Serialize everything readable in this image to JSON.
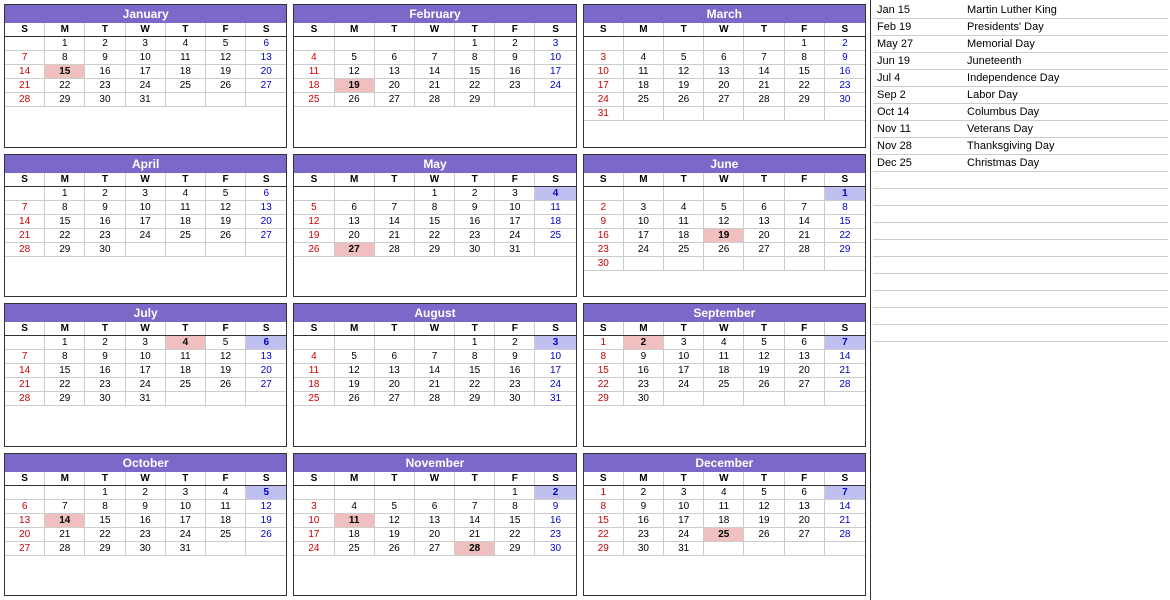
{
  "calendar": {
    "months": [
      {
        "name": "January",
        "startDay": 1,
        "days": 31,
        "weeks": [
          [
            null,
            1,
            2,
            3,
            4,
            5,
            6
          ],
          [
            7,
            8,
            9,
            10,
            11,
            12,
            13
          ],
          [
            14,
            15,
            16,
            17,
            18,
            19,
            20
          ],
          [
            21,
            22,
            23,
            24,
            25,
            26,
            27
          ],
          [
            28,
            29,
            30,
            31,
            null,
            null,
            null
          ]
        ],
        "holidays": [
          15
        ],
        "holidaySat": [],
        "redSundays": [
          7,
          14,
          21,
          28
        ],
        "blueSaturdays": [
          6,
          13,
          20,
          27
        ]
      },
      {
        "name": "February",
        "startDay": 4,
        "days": 29,
        "weeks": [
          [
            null,
            null,
            null,
            null,
            1,
            2,
            3
          ],
          [
            4,
            5,
            6,
            7,
            8,
            9,
            10
          ],
          [
            11,
            12,
            13,
            14,
            15,
            16,
            17
          ],
          [
            18,
            19,
            20,
            21,
            22,
            23,
            24
          ],
          [
            25,
            26,
            27,
            28,
            29,
            null,
            null
          ]
        ],
        "holidays": [
          19
        ],
        "holidaySat": [],
        "redSundays": [
          4,
          11,
          18,
          25
        ],
        "blueSaturdays": [
          3,
          10,
          17,
          24
        ]
      },
      {
        "name": "March",
        "startDay": 5,
        "days": 31,
        "weeks": [
          [
            null,
            null,
            null,
            null,
            null,
            1,
            2
          ],
          [
            3,
            4,
            5,
            6,
            7,
            8,
            9
          ],
          [
            10,
            11,
            12,
            13,
            14,
            15,
            16
          ],
          [
            17,
            18,
            19,
            20,
            21,
            22,
            23
          ],
          [
            24,
            25,
            26,
            27,
            28,
            29,
            30
          ],
          [
            31,
            null,
            null,
            null,
            null,
            null,
            null
          ]
        ],
        "holidays": [],
        "holidaySat": [],
        "redSundays": [
          3,
          10,
          17,
          24,
          31
        ],
        "blueSaturdays": [
          2,
          9,
          16,
          23,
          30
        ]
      },
      {
        "name": "April",
        "startDay": 1,
        "days": 30,
        "weeks": [
          [
            null,
            1,
            2,
            3,
            4,
            5,
            6
          ],
          [
            7,
            8,
            9,
            10,
            11,
            12,
            13
          ],
          [
            14,
            15,
            16,
            17,
            18,
            19,
            20
          ],
          [
            21,
            22,
            23,
            24,
            25,
            26,
            27
          ],
          [
            28,
            29,
            30,
            null,
            null,
            null,
            null
          ]
        ],
        "holidays": [],
        "holidaySat": [],
        "redSundays": [
          7,
          14,
          21,
          28
        ],
        "blueSaturdays": [
          6,
          13,
          20,
          27
        ]
      },
      {
        "name": "May",
        "startDay": 3,
        "days": 31,
        "weeks": [
          [
            null,
            null,
            null,
            1,
            2,
            3,
            4
          ],
          [
            5,
            6,
            7,
            8,
            9,
            10,
            11
          ],
          [
            12,
            13,
            14,
            15,
            16,
            17,
            18
          ],
          [
            19,
            20,
            21,
            22,
            23,
            24,
            25
          ],
          [
            26,
            27,
            28,
            29,
            30,
            31,
            null
          ]
        ],
        "holidays": [
          27
        ],
        "holidaySat": [
          4
        ],
        "redSundays": [
          5,
          12,
          19,
          26
        ],
        "blueSaturdays": [
          4,
          11,
          18,
          25
        ]
      },
      {
        "name": "June",
        "startDay": 6,
        "days": 30,
        "weeks": [
          [
            null,
            null,
            null,
            null,
            null,
            null,
            1
          ],
          [
            2,
            3,
            4,
            5,
            6,
            7,
            8
          ],
          [
            9,
            10,
            11,
            12,
            13,
            14,
            15
          ],
          [
            16,
            17,
            18,
            19,
            20,
            21,
            22
          ],
          [
            23,
            24,
            25,
            26,
            27,
            28,
            29
          ],
          [
            30,
            null,
            null,
            null,
            null,
            null,
            null
          ]
        ],
        "holidays": [
          19
        ],
        "holidaySat": [
          1
        ],
        "redSundays": [
          2,
          9,
          16,
          23,
          30
        ],
        "blueSaturdays": [
          1,
          8,
          15,
          22,
          29
        ]
      },
      {
        "name": "July",
        "startDay": 1,
        "days": 31,
        "weeks": [
          [
            null,
            1,
            2,
            3,
            4,
            5,
            6
          ],
          [
            7,
            8,
            9,
            10,
            11,
            12,
            13
          ],
          [
            14,
            15,
            16,
            17,
            18,
            19,
            20
          ],
          [
            21,
            22,
            23,
            24,
            25,
            26,
            27
          ],
          [
            28,
            29,
            30,
            31,
            null,
            null,
            null
          ]
        ],
        "holidays": [
          4
        ],
        "holidaySat": [
          6
        ],
        "redSundays": [
          7,
          14,
          21,
          28
        ],
        "blueSaturdays": [
          6,
          13,
          20,
          27
        ]
      },
      {
        "name": "August",
        "startDay": 4,
        "days": 31,
        "weeks": [
          [
            null,
            null,
            null,
            null,
            1,
            2,
            3
          ],
          [
            4,
            5,
            6,
            7,
            8,
            9,
            10
          ],
          [
            11,
            12,
            13,
            14,
            15,
            16,
            17
          ],
          [
            18,
            19,
            20,
            21,
            22,
            23,
            24
          ],
          [
            25,
            26,
            27,
            28,
            29,
            30,
            31
          ]
        ],
        "holidays": [],
        "holidaySat": [
          3
        ],
        "redSundays": [
          4,
          11,
          18,
          25
        ],
        "blueSaturdays": [
          3,
          10,
          17,
          24,
          31
        ]
      },
      {
        "name": "September",
        "startDay": 0,
        "days": 30,
        "weeks": [
          [
            1,
            2,
            3,
            4,
            5,
            6,
            7
          ],
          [
            8,
            9,
            10,
            11,
            12,
            13,
            14
          ],
          [
            15,
            16,
            17,
            18,
            19,
            20,
            21
          ],
          [
            22,
            23,
            24,
            25,
            26,
            27,
            28
          ],
          [
            29,
            30,
            null,
            null,
            null,
            null,
            null
          ]
        ],
        "holidays": [
          2
        ],
        "holidaySat": [
          7
        ],
        "redSundays": [
          1,
          8,
          15,
          22,
          29
        ],
        "blueSaturdays": [
          7,
          14,
          21,
          28
        ]
      },
      {
        "name": "October",
        "startDay": 2,
        "days": 31,
        "weeks": [
          [
            null,
            null,
            1,
            2,
            3,
            4,
            5
          ],
          [
            6,
            7,
            8,
            9,
            10,
            11,
            12
          ],
          [
            13,
            14,
            15,
            16,
            17,
            18,
            19
          ],
          [
            20,
            21,
            22,
            23,
            24,
            25,
            26
          ],
          [
            27,
            28,
            29,
            30,
            31,
            null,
            null
          ]
        ],
        "holidays": [
          14
        ],
        "holidaySat": [
          5
        ],
        "redSundays": [
          6,
          13,
          20,
          27
        ],
        "blueSaturdays": [
          5,
          12,
          19,
          26
        ]
      },
      {
        "name": "November",
        "startDay": 5,
        "days": 30,
        "weeks": [
          [
            null,
            null,
            null,
            null,
            null,
            1,
            2
          ],
          [
            3,
            4,
            5,
            6,
            7,
            8,
            9
          ],
          [
            10,
            11,
            12,
            13,
            14,
            15,
            16
          ],
          [
            17,
            18,
            19,
            20,
            21,
            22,
            23
          ],
          [
            24,
            25,
            26,
            27,
            28,
            29,
            30
          ]
        ],
        "holidays": [
          11,
          28
        ],
        "holidaySat": [
          2
        ],
        "redSundays": [
          3,
          10,
          17,
          24
        ],
        "blueSaturdays": [
          2,
          9,
          16,
          23,
          30
        ]
      },
      {
        "name": "December",
        "startDay": 0,
        "days": 31,
        "weeks": [
          [
            1,
            2,
            3,
            4,
            5,
            6,
            7
          ],
          [
            8,
            9,
            10,
            11,
            12,
            13,
            14
          ],
          [
            15,
            16,
            17,
            18,
            19,
            20,
            21
          ],
          [
            22,
            23,
            24,
            25,
            26,
            27,
            28
          ],
          [
            29,
            30,
            31,
            null,
            null,
            null,
            null
          ]
        ],
        "holidays": [
          25
        ],
        "holidaySat": [
          7
        ],
        "redSundays": [
          1,
          8,
          15,
          22,
          29
        ],
        "blueSaturdays": [
          7,
          14,
          21,
          28
        ]
      }
    ],
    "dayHeaders": [
      "S",
      "M",
      "T",
      "W",
      "T",
      "F",
      "S"
    ]
  },
  "holidays": [
    {
      "date": "Jan 15",
      "name": "Martin Luther King"
    },
    {
      "date": "Feb 19",
      "name": "Presidents' Day"
    },
    {
      "date": "May 27",
      "name": "Memorial Day"
    },
    {
      "date": "Jun 19",
      "name": "Juneteenth"
    },
    {
      "date": "Jul 4",
      "name": "Independence Day"
    },
    {
      "date": "Sep 2",
      "name": "Labor Day"
    },
    {
      "date": "Oct 14",
      "name": "Columbus Day"
    },
    {
      "date": "Nov 11",
      "name": "Veterans Day"
    },
    {
      "date": "Nov 28",
      "name": "Thanksgiving Day"
    },
    {
      "date": "Dec 25",
      "name": "Christmas Day"
    }
  ]
}
